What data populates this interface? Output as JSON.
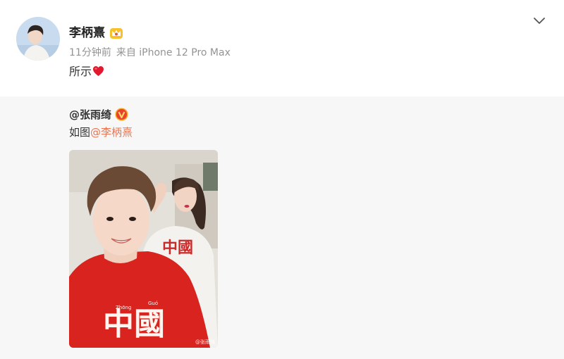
{
  "post": {
    "author": "李柄熹",
    "time": "11分钟前",
    "source": "来自 iPhone 12 Pro Max",
    "text": "所示"
  },
  "repost": {
    "original_author": "@张雨绮",
    "text_prefix": "如图",
    "mention": "@李柄熹",
    "photo": {
      "watermark": "@张雨绮"
    }
  },
  "colors": {
    "mention": "#eb7350",
    "repost_bg": "#f7f7f7",
    "meta_text": "#939393"
  },
  "icons": {
    "crown_badge": "crown-badge-icon",
    "verified_badge": "verified-v-icon",
    "heart": "red-heart-emoji",
    "expand": "chevron-down-icon"
  }
}
